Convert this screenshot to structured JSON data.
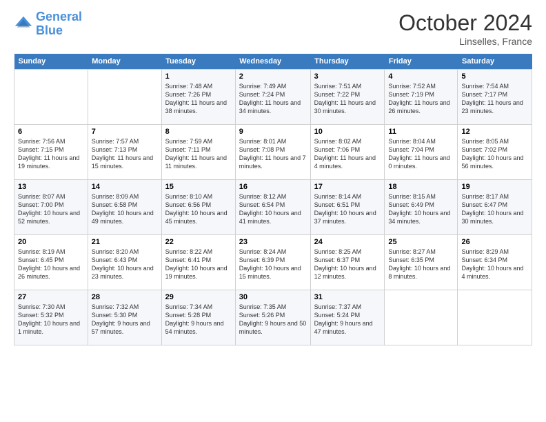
{
  "header": {
    "logo_line1": "General",
    "logo_line2": "Blue",
    "month": "October 2024",
    "location": "Linselles, France"
  },
  "weekdays": [
    "Sunday",
    "Monday",
    "Tuesday",
    "Wednesday",
    "Thursday",
    "Friday",
    "Saturday"
  ],
  "weeks": [
    [
      {
        "day": "",
        "sunrise": "",
        "sunset": "",
        "daylight": ""
      },
      {
        "day": "",
        "sunrise": "",
        "sunset": "",
        "daylight": ""
      },
      {
        "day": "1",
        "sunrise": "Sunrise: 7:48 AM",
        "sunset": "Sunset: 7:26 PM",
        "daylight": "Daylight: 11 hours and 38 minutes."
      },
      {
        "day": "2",
        "sunrise": "Sunrise: 7:49 AM",
        "sunset": "Sunset: 7:24 PM",
        "daylight": "Daylight: 11 hours and 34 minutes."
      },
      {
        "day": "3",
        "sunrise": "Sunrise: 7:51 AM",
        "sunset": "Sunset: 7:22 PM",
        "daylight": "Daylight: 11 hours and 30 minutes."
      },
      {
        "day": "4",
        "sunrise": "Sunrise: 7:52 AM",
        "sunset": "Sunset: 7:19 PM",
        "daylight": "Daylight: 11 hours and 26 minutes."
      },
      {
        "day": "5",
        "sunrise": "Sunrise: 7:54 AM",
        "sunset": "Sunset: 7:17 PM",
        "daylight": "Daylight: 11 hours and 23 minutes."
      }
    ],
    [
      {
        "day": "6",
        "sunrise": "Sunrise: 7:56 AM",
        "sunset": "Sunset: 7:15 PM",
        "daylight": "Daylight: 11 hours and 19 minutes."
      },
      {
        "day": "7",
        "sunrise": "Sunrise: 7:57 AM",
        "sunset": "Sunset: 7:13 PM",
        "daylight": "Daylight: 11 hours and 15 minutes."
      },
      {
        "day": "8",
        "sunrise": "Sunrise: 7:59 AM",
        "sunset": "Sunset: 7:11 PM",
        "daylight": "Daylight: 11 hours and 11 minutes."
      },
      {
        "day": "9",
        "sunrise": "Sunrise: 8:01 AM",
        "sunset": "Sunset: 7:08 PM",
        "daylight": "Daylight: 11 hours and 7 minutes."
      },
      {
        "day": "10",
        "sunrise": "Sunrise: 8:02 AM",
        "sunset": "Sunset: 7:06 PM",
        "daylight": "Daylight: 11 hours and 4 minutes."
      },
      {
        "day": "11",
        "sunrise": "Sunrise: 8:04 AM",
        "sunset": "Sunset: 7:04 PM",
        "daylight": "Daylight: 11 hours and 0 minutes."
      },
      {
        "day": "12",
        "sunrise": "Sunrise: 8:05 AM",
        "sunset": "Sunset: 7:02 PM",
        "daylight": "Daylight: 10 hours and 56 minutes."
      }
    ],
    [
      {
        "day": "13",
        "sunrise": "Sunrise: 8:07 AM",
        "sunset": "Sunset: 7:00 PM",
        "daylight": "Daylight: 10 hours and 52 minutes."
      },
      {
        "day": "14",
        "sunrise": "Sunrise: 8:09 AM",
        "sunset": "Sunset: 6:58 PM",
        "daylight": "Daylight: 10 hours and 49 minutes."
      },
      {
        "day": "15",
        "sunrise": "Sunrise: 8:10 AM",
        "sunset": "Sunset: 6:56 PM",
        "daylight": "Daylight: 10 hours and 45 minutes."
      },
      {
        "day": "16",
        "sunrise": "Sunrise: 8:12 AM",
        "sunset": "Sunset: 6:54 PM",
        "daylight": "Daylight: 10 hours and 41 minutes."
      },
      {
        "day": "17",
        "sunrise": "Sunrise: 8:14 AM",
        "sunset": "Sunset: 6:51 PM",
        "daylight": "Daylight: 10 hours and 37 minutes."
      },
      {
        "day": "18",
        "sunrise": "Sunrise: 8:15 AM",
        "sunset": "Sunset: 6:49 PM",
        "daylight": "Daylight: 10 hours and 34 minutes."
      },
      {
        "day": "19",
        "sunrise": "Sunrise: 8:17 AM",
        "sunset": "Sunset: 6:47 PM",
        "daylight": "Daylight: 10 hours and 30 minutes."
      }
    ],
    [
      {
        "day": "20",
        "sunrise": "Sunrise: 8:19 AM",
        "sunset": "Sunset: 6:45 PM",
        "daylight": "Daylight: 10 hours and 26 minutes."
      },
      {
        "day": "21",
        "sunrise": "Sunrise: 8:20 AM",
        "sunset": "Sunset: 6:43 PM",
        "daylight": "Daylight: 10 hours and 23 minutes."
      },
      {
        "day": "22",
        "sunrise": "Sunrise: 8:22 AM",
        "sunset": "Sunset: 6:41 PM",
        "daylight": "Daylight: 10 hours and 19 minutes."
      },
      {
        "day": "23",
        "sunrise": "Sunrise: 8:24 AM",
        "sunset": "Sunset: 6:39 PM",
        "daylight": "Daylight: 10 hours and 15 minutes."
      },
      {
        "day": "24",
        "sunrise": "Sunrise: 8:25 AM",
        "sunset": "Sunset: 6:37 PM",
        "daylight": "Daylight: 10 hours and 12 minutes."
      },
      {
        "day": "25",
        "sunrise": "Sunrise: 8:27 AM",
        "sunset": "Sunset: 6:35 PM",
        "daylight": "Daylight: 10 hours and 8 minutes."
      },
      {
        "day": "26",
        "sunrise": "Sunrise: 8:29 AM",
        "sunset": "Sunset: 6:34 PM",
        "daylight": "Daylight: 10 hours and 4 minutes."
      }
    ],
    [
      {
        "day": "27",
        "sunrise": "Sunrise: 7:30 AM",
        "sunset": "Sunset: 5:32 PM",
        "daylight": "Daylight: 10 hours and 1 minute."
      },
      {
        "day": "28",
        "sunrise": "Sunrise: 7:32 AM",
        "sunset": "Sunset: 5:30 PM",
        "daylight": "Daylight: 9 hours and 57 minutes."
      },
      {
        "day": "29",
        "sunrise": "Sunrise: 7:34 AM",
        "sunset": "Sunset: 5:28 PM",
        "daylight": "Daylight: 9 hours and 54 minutes."
      },
      {
        "day": "30",
        "sunrise": "Sunrise: 7:35 AM",
        "sunset": "Sunset: 5:26 PM",
        "daylight": "Daylight: 9 hours and 50 minutes."
      },
      {
        "day": "31",
        "sunrise": "Sunrise: 7:37 AM",
        "sunset": "Sunset: 5:24 PM",
        "daylight": "Daylight: 9 hours and 47 minutes."
      },
      {
        "day": "",
        "sunrise": "",
        "sunset": "",
        "daylight": ""
      },
      {
        "day": "",
        "sunrise": "",
        "sunset": "",
        "daylight": ""
      }
    ]
  ]
}
